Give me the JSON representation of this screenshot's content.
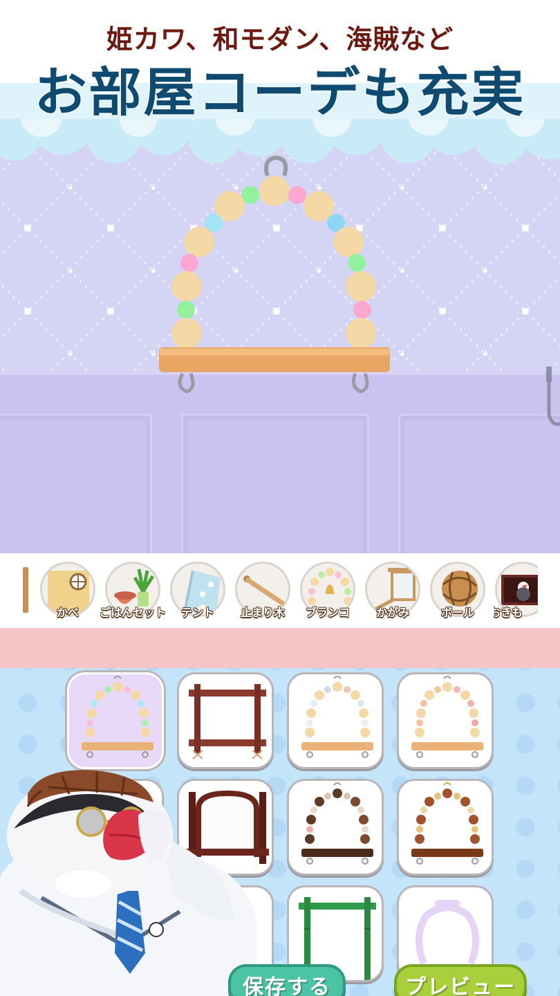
{
  "banner": {
    "subtitle": "姫カワ、和モダン、海賊など",
    "title": "お部屋コーデも充実"
  },
  "categories": [
    {
      "label": "かべ",
      "icon": "wall-icon"
    },
    {
      "label": "ごはんセット",
      "icon": "food-set-icon"
    },
    {
      "label": "テント",
      "icon": "tent-icon"
    },
    {
      "label": "止まり木",
      "icon": "perch-icon"
    },
    {
      "label": "ブランコ",
      "icon": "swing-icon"
    },
    {
      "label": "かがみ",
      "icon": "mirror-icon"
    },
    {
      "label": "ボール",
      "icon": "ball-icon"
    },
    {
      "label": "おきも",
      "icon": "ornament-icon"
    }
  ],
  "grid": {
    "items": [
      {
        "icon": "pastel-swing-icon",
        "selected": true
      },
      {
        "icon": "wooden-frame-swing-icon"
      },
      {
        "icon": "bead-swing-icon"
      },
      {
        "icon": "pastel-bead-swing-icon"
      },
      {
        "icon": "mascot-covered-item-icon"
      },
      {
        "icon": "dark-wood-mirror-icon"
      },
      {
        "icon": "dark-bead-swing-icon"
      },
      {
        "icon": "brown-bead-swing-icon"
      },
      {
        "icon": "mascot-covered-item-icon"
      },
      {
        "icon": "mascot-covered-item-icon"
      },
      {
        "icon": "green-bamboo-frame-icon"
      },
      {
        "icon": "lavender-ring-icon"
      }
    ]
  },
  "buttons": {
    "save": "保存する",
    "preview": "プレビュー"
  },
  "colors": {
    "headline_sub": "#6b1a12",
    "headline_main": "#0f4a70",
    "save_button": "#4cc3a4",
    "preview_button": "#a9cf3c",
    "category_strip": "#f5c4c6",
    "grid_background": "#c4e4fa"
  }
}
